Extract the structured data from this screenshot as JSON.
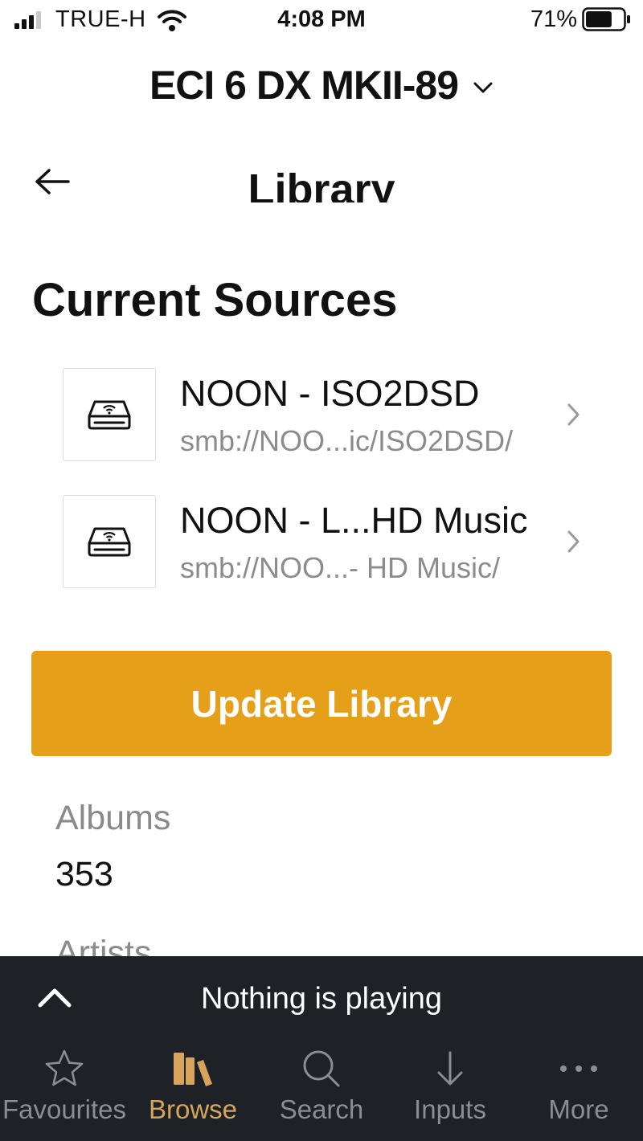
{
  "status_bar": {
    "carrier": "TRUE-H",
    "time": "4:08 PM",
    "battery_percent": "71%",
    "battery_level": 0.71
  },
  "device": {
    "name": "ECI 6 DX MKII-89"
  },
  "header": {
    "title": "Library"
  },
  "sources": {
    "title": "Current Sources",
    "items": [
      {
        "name": "NOON - ISO2DSD",
        "path": "smb://NOO...ic/ISO2DSD/"
      },
      {
        "name": "NOON - L...HD Music",
        "path": "smb://NOO...- HD Music/"
      }
    ]
  },
  "update_button": {
    "label": "Update Library",
    "color": "#e59f19"
  },
  "stats": {
    "albums_label": "Albums",
    "albums_value": "353",
    "artists_label": "Artists"
  },
  "now_playing": {
    "text": "Nothing is playing"
  },
  "tabs": [
    {
      "label": "Favourites",
      "icon": "star-icon",
      "active": false
    },
    {
      "label": "Browse",
      "icon": "library-icon",
      "active": true
    },
    {
      "label": "Search",
      "icon": "search-icon",
      "active": false
    },
    {
      "label": "Inputs",
      "icon": "arrow-down-icon",
      "active": false
    },
    {
      "label": "More",
      "icon": "more-dots-icon",
      "active": false
    }
  ],
  "colors": {
    "accent": "#e59f19",
    "tab_active": "#d6a55b",
    "tab_inactive": "#8a8e93",
    "bottom_bar": "#1e2226"
  }
}
